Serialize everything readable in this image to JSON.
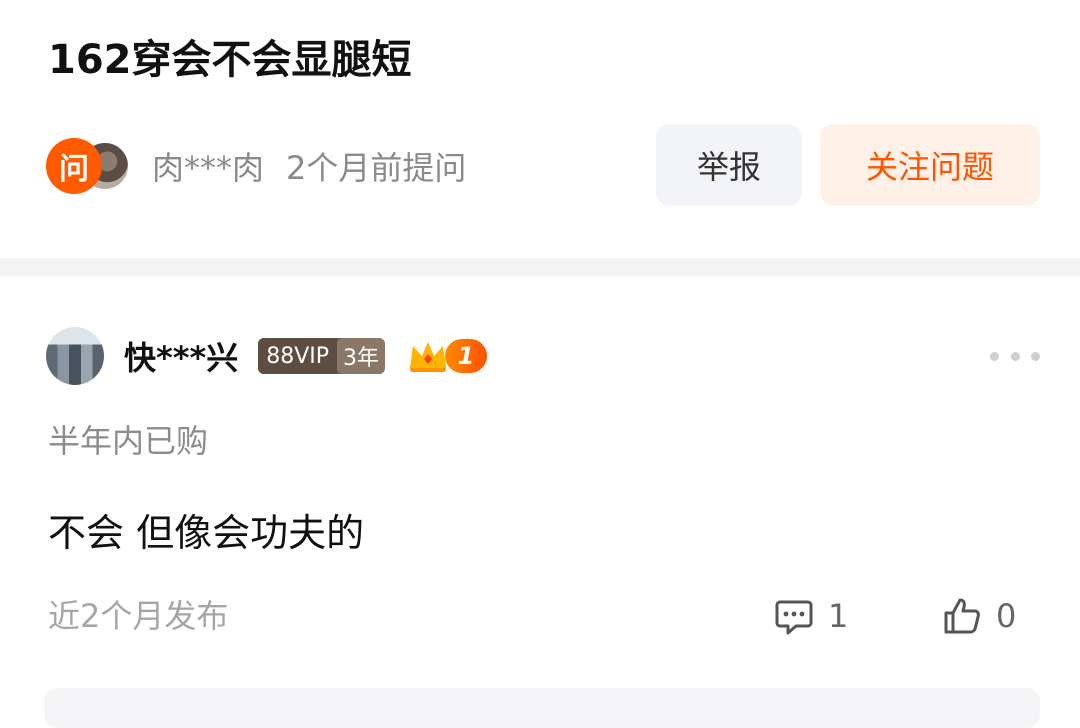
{
  "question": {
    "title": "162穿会不会显腿短",
    "ask_badge": "问",
    "asker_name": "肉***肉",
    "asked_time": "2个月前提问",
    "report_label": "举报",
    "follow_label": "关注问题"
  },
  "answer": {
    "user_name": "快***兴",
    "vip_label": "88VIP",
    "vip_years": "3年",
    "level": "1",
    "purchase_tag": "半年内已购",
    "content": "不会 但像会功夫的",
    "publish_time": "近2个月发布",
    "comment_count": "1",
    "like_count": "0"
  },
  "colors": {
    "accent": "#ff5500",
    "ask_badge_bg": "#ff5a00",
    "follow_bg": "#fff1e8",
    "report_bg": "#f3f4f7",
    "muted_text": "#8a8a8a"
  },
  "icons": {
    "crown": "crown-icon",
    "more": "more-dots-icon",
    "comment": "comment-icon",
    "like": "thumbs-up-icon"
  }
}
